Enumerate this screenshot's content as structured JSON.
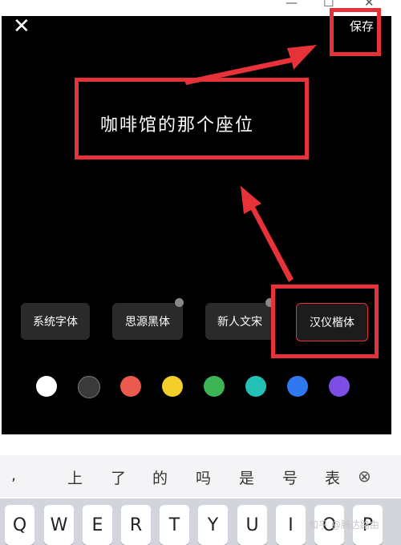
{
  "window": {
    "minimize_label": "—",
    "maximize_label": "☐",
    "close_label": "✕"
  },
  "editor": {
    "close_label": "✕",
    "save_label": "保存",
    "text": "咖啡馆的那个座位",
    "fonts": [
      {
        "label": "系统字体",
        "selected": false,
        "downloadable": false
      },
      {
        "label": "思源黑体",
        "selected": false,
        "downloadable": true
      },
      {
        "label": "新人文宋",
        "selected": false,
        "downloadable": true
      },
      {
        "label": "汉仪楷体",
        "selected": true,
        "downloadable": false
      }
    ],
    "colors": [
      "#ffffff",
      "#3a3a3a",
      "#ea5a4d",
      "#f2cf2a",
      "#3cb454",
      "#23c0b8",
      "#2f78f0",
      "#7c4ee6"
    ],
    "annotation_color": "#e8323a"
  },
  "keyboard": {
    "candidates": [
      ",",
      "上",
      "了",
      "的",
      "吗",
      "是",
      "号",
      "表"
    ],
    "delete_label": "⊗",
    "keys": [
      "Q",
      "W",
      "E",
      "R",
      "T",
      "Y",
      "U",
      "I",
      "O",
      "P"
    ],
    "watermark": "知乎 @腾达路由"
  }
}
